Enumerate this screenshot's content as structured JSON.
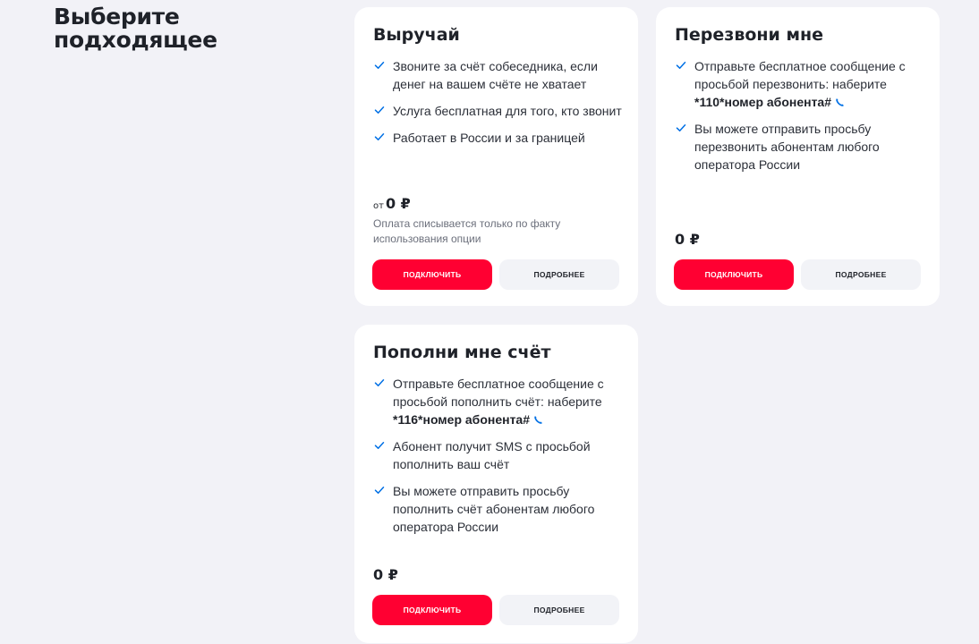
{
  "page": {
    "title": "Выберите подходящее"
  },
  "colors": {
    "accent": "#ff0032",
    "check": "#0070e5",
    "background": "#f2f2f7"
  },
  "cards": [
    {
      "title": "Выручай",
      "features": [
        {
          "text": "Звоните за счёт собеседника, если денег на вашем счёте не хватает"
        },
        {
          "text": "Услуга бесплатная для того, кто звонит"
        },
        {
          "text": "Работает в России и за границей"
        }
      ],
      "price_prefix": "от",
      "price": "0 ₽",
      "price_note": "Оплата списывается только по факту использования опции",
      "connect_label": "ПОДКЛЮЧИТЬ",
      "details_label": "ПОДРОБНЕЕ"
    },
    {
      "title": "Перезвони мне",
      "features": [
        {
          "text": "Отправьте бесплатное сообщение с просьбой перезвонить: наберите",
          "code": "*110*номер абонента#"
        },
        {
          "text": "Вы можете отправить просьбу перезвонить абонентам любого оператора России"
        }
      ],
      "price": "0 ₽",
      "connect_label": "ПОДКЛЮЧИТЬ",
      "details_label": "ПОДРОБНЕЕ"
    },
    {
      "title": "Пополни мне счёт",
      "features": [
        {
          "text": "Отправьте бесплатное сообщение с просьбой пополнить счёт: наберите",
          "code": "*116*номер абонента#"
        },
        {
          "text": "Абонент получит SMS с просьбой пополнить ваш счёт"
        },
        {
          "text": "Вы можете отправить просьбу пополнить счёт абонентам любого оператора России"
        }
      ],
      "price": "0 ₽",
      "connect_label": "ПОДКЛЮЧИТЬ",
      "details_label": "ПОДРОБНЕЕ"
    }
  ]
}
